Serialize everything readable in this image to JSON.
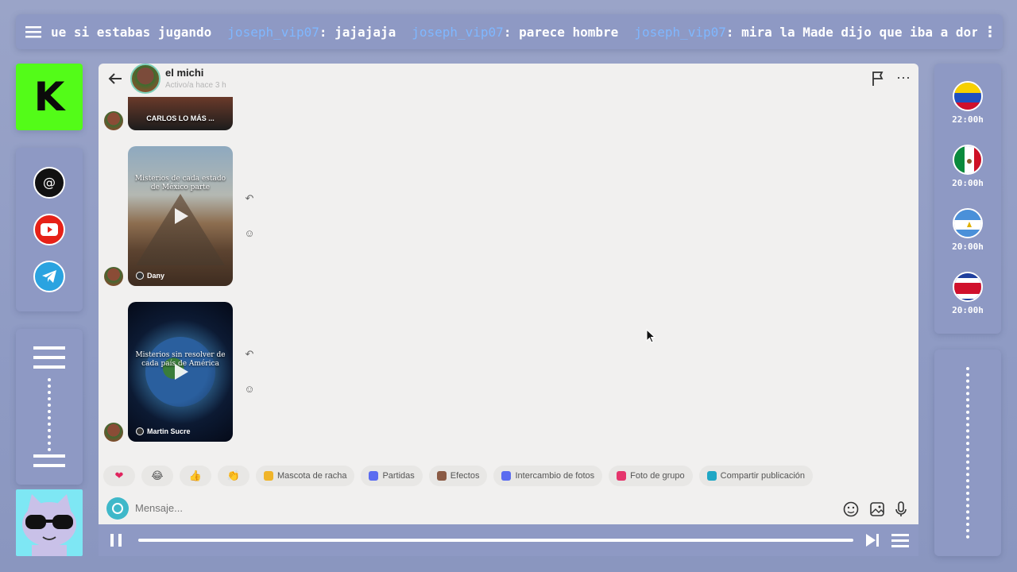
{
  "ticker": {
    "messages": [
      {
        "user": "",
        "text": "ue si estabas jugando"
      },
      {
        "user": "joseph_vip07",
        "text": " : jajajaja"
      },
      {
        "user": "joseph_vip07",
        "text": " : parece hombre"
      },
      {
        "user": "joseph_vip07",
        "text": " : mira la Made dijo que iba a dormir y está en línea jajaja"
      }
    ]
  },
  "kick": {
    "logo_letter": "K"
  },
  "socials": [
    "threads-icon",
    "youtube-icon",
    "telegram-icon"
  ],
  "chat": {
    "name": "el michi",
    "status": "Activo/a hace 3 h",
    "reels": [
      {
        "label": "CARLOS LO MÁS ..."
      },
      {
        "caption": "Misterios de cada estado de México parte",
        "author": "Dany"
      },
      {
        "caption": "Misterios sin resolver de cada país de América",
        "author": "Martin Sucre"
      }
    ],
    "quick_actions": [
      {
        "label": "",
        "emoji": "❤"
      },
      {
        "label": "",
        "emoji": "😂"
      },
      {
        "label": "",
        "emoji": "👍"
      },
      {
        "label": "",
        "emoji": "👏"
      },
      {
        "label": "Mascota de racha",
        "color": "#f0b429"
      },
      {
        "label": "Partidas",
        "color": "#5b6cf0"
      },
      {
        "label": "Efectos",
        "color": "#8a5a44"
      },
      {
        "label": "Intercambio de fotos",
        "color": "#5b6cf0"
      },
      {
        "label": "Foto de grupo",
        "color": "#e5356c"
      },
      {
        "label": "Compartir publicación",
        "color": "#1fa7c5"
      }
    ],
    "composer": {
      "placeholder": "Mensaje..."
    }
  },
  "schedule": [
    {
      "country": "venezuela-flag-icon",
      "time": "22:00h"
    },
    {
      "country": "mexico-flag-icon",
      "time": "20:00h"
    },
    {
      "country": "nicaragua-flag-icon",
      "time": "20:00h"
    },
    {
      "country": "costa-rica-flag-icon",
      "time": "20:00h"
    }
  ],
  "colors": {
    "accent_blue": "#7fb7ff",
    "kick_green": "#53fc18",
    "panel": "#8e99c4"
  }
}
